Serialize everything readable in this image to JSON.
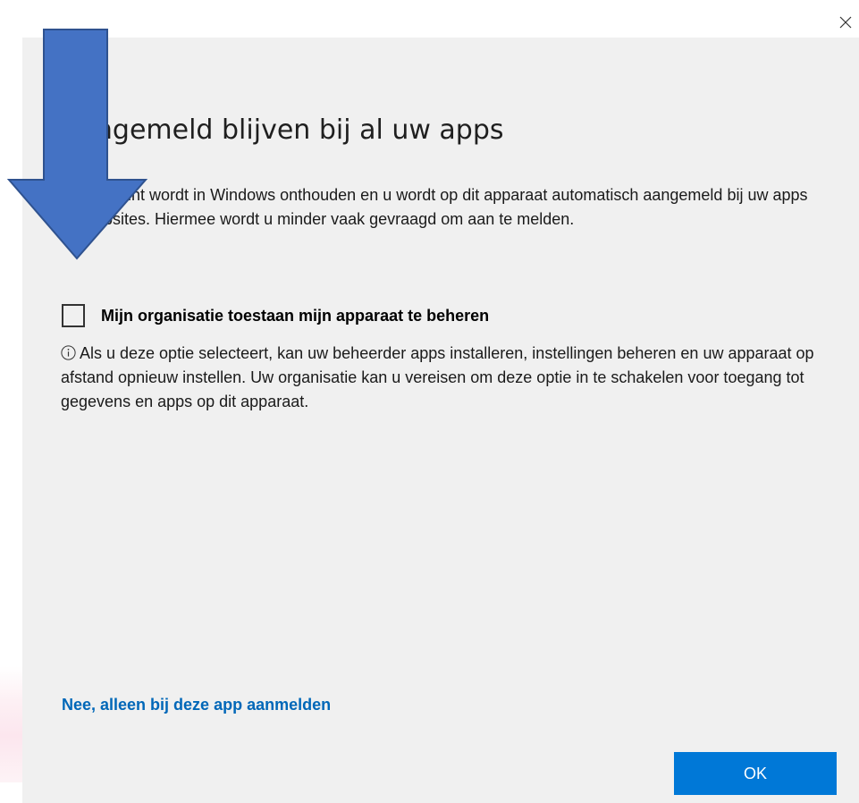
{
  "dialog": {
    "title": "Aangemeld blijven bij al uw apps",
    "description": "Uw account wordt in Windows onthouden en u wordt op dit apparaat automatisch aangemeld bij uw apps en websites. Hiermee wordt u minder vaak gevraagd om aan te melden.",
    "checkbox": {
      "label": "Mijn organisatie toestaan mijn apparaat te beheren",
      "checked": false
    },
    "info_text": "Als u deze optie selecteert, kan uw beheerder apps installeren, instellingen beheren en uw apparaat op afstand opnieuw instellen. Uw organisatie kan u vereisen om deze optie in te schakelen voor toegang tot gegevens en apps op dit apparaat.",
    "link_label": "Nee, alleen bij deze app aanmelden",
    "ok_label": "OK"
  },
  "icons": {
    "close": "close-icon",
    "info": "info-icon",
    "annotation": "arrow-down-icon"
  },
  "colors": {
    "panel_background": "#f0f0f0",
    "link": "#0067b8",
    "button": "#0078d7",
    "annotation_arrow": "#4472c4",
    "annotation_arrow_outline": "#2f528f"
  }
}
